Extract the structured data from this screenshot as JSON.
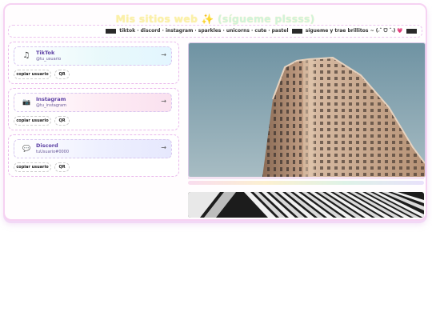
{
  "header": {
    "title_main": "Mis sitios web",
    "title_sparkle": "✨",
    "title_sub": "(sígueme plssss)"
  },
  "marquee": {
    "items": [
      "tiktok",
      "discord",
      "instagram",
      "sparkles",
      "unicorns",
      "cute",
      "pastel"
    ],
    "separator": "·",
    "tail": "sígueme y trae brillitos ~ (˶ˆ ᗜ ˆ˵)",
    "heart": "💗"
  },
  "links": [
    {
      "icon": "music-note-icon",
      "glyph": "♫",
      "name": "TikTok",
      "handle": "@tu_usuario",
      "arrow": "→",
      "copy_label": "copiar usuario",
      "qr_label": "QR"
    },
    {
      "icon": "camera-icon",
      "glyph": "📷",
      "name": "Instagram",
      "handle": "@tu_instagram",
      "arrow": "→",
      "copy_label": "copiar usuario",
      "qr_label": "QR"
    },
    {
      "icon": "speech-bubble-icon",
      "glyph": "💬",
      "name": "Discord",
      "handle": "tuUsuario#0000",
      "arrow": "→",
      "copy_label": "copiar usuario",
      "qr_label": "QR"
    }
  ],
  "colors": {
    "accent_pink": "#f6d2f2",
    "title_yellow": "#fbf0a8",
    "link_purple": "#5b3fa3"
  }
}
